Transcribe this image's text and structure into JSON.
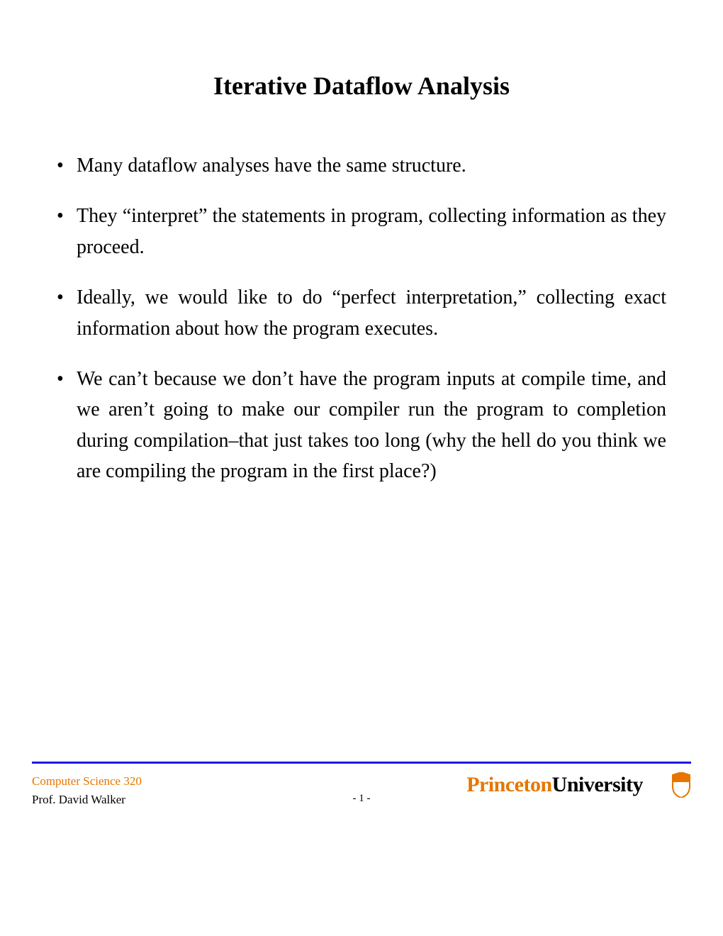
{
  "title": "Iterative Dataflow Analysis",
  "bullets": [
    "Many dataflow analyses have the same structure.",
    "They “interpret” the statements in program, collecting information as they proceed.",
    "Ideally, we would like to do “perfect interpretation,” collecting exact information about how the program executes.",
    "We can’t because we don’t have the program inputs at compile time, and we aren’t going to make our compiler run the program to completion during compilation–that just takes too long (why the hell do you think we are compiling the program in the first place?)"
  ],
  "footer": {
    "course": "Computer Science 320",
    "instructor": "Prof. David Walker",
    "university_part1": "Princeton",
    "university_part2": "University",
    "page_label": "- 1 -"
  }
}
